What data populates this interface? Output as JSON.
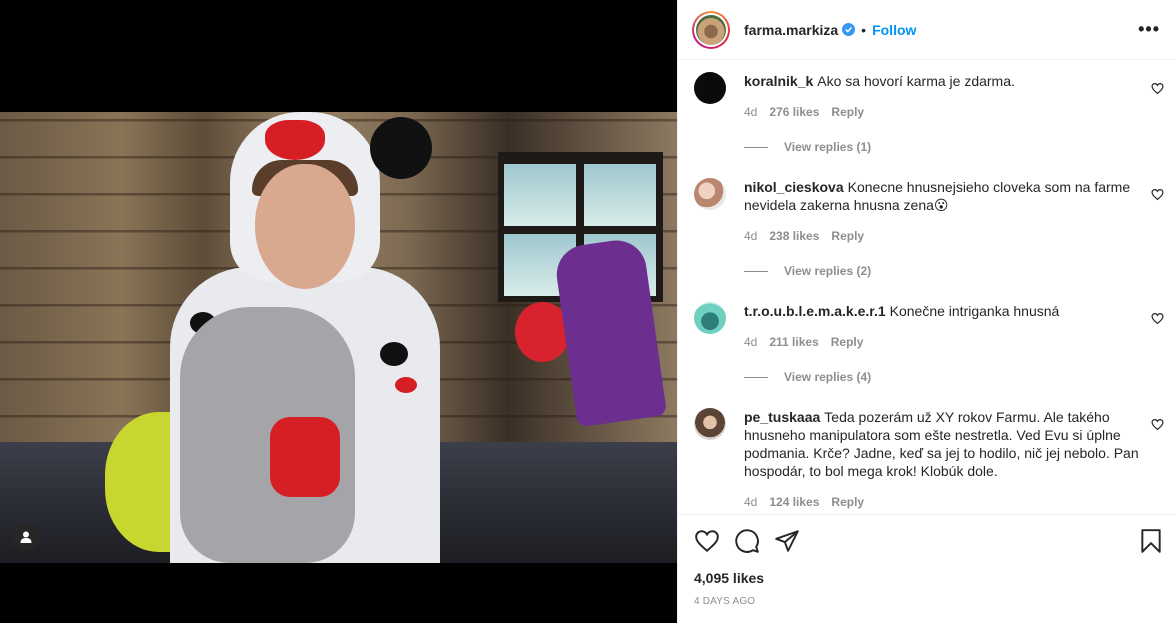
{
  "header": {
    "username": "farma.markiza",
    "separator": "•",
    "follow_label": "Follow",
    "more_label": "•••"
  },
  "comments": [
    {
      "username": "koralnik_k",
      "text": "Ako sa hovorí karma je zdarma.",
      "age": "4d",
      "likes": "276 likes",
      "reply_label": "Reply",
      "view_replies": "View replies (1)",
      "avatar_color": "#0b0b0b"
    },
    {
      "username": "nikol_cieskova",
      "text": "Konecne hnusnejsieho cloveka som na farme nevidela zakerna hnusna zena😮",
      "age": "4d",
      "likes": "238 likes",
      "reply_label": "Reply",
      "view_replies": "View replies (2)",
      "avatar_color": "#c8a58d"
    },
    {
      "username": "t.r.o.u.b.l.e.m.a.k.e.r.1",
      "text": "Konečne intriganka hnusná",
      "age": "4d",
      "likes": "211 likes",
      "reply_label": "Reply",
      "view_replies": "View replies (4)",
      "avatar_color": "#4fb3a6"
    },
    {
      "username": "pe_tuskaaa",
      "text": "Teda pozerám už XY rokov Farmu. Ale takého hnusneho manipulatora som ešte nestretla. Ved Evu si úplne podmania. Krče? Jadne, keď sa jej to hodilo, nič jej nebolo. Pan hospodár, to bol mega krok! Klobúk dole.",
      "age": "4d",
      "likes": "124 likes",
      "reply_label": "Reply",
      "avatar_color": "#8a7060"
    }
  ],
  "post": {
    "likes": "4,095 likes",
    "date": "4 DAYS AGO"
  },
  "colors": {
    "accent": "#0095f6",
    "muted": "#8e8e8e",
    "text": "#262626"
  }
}
